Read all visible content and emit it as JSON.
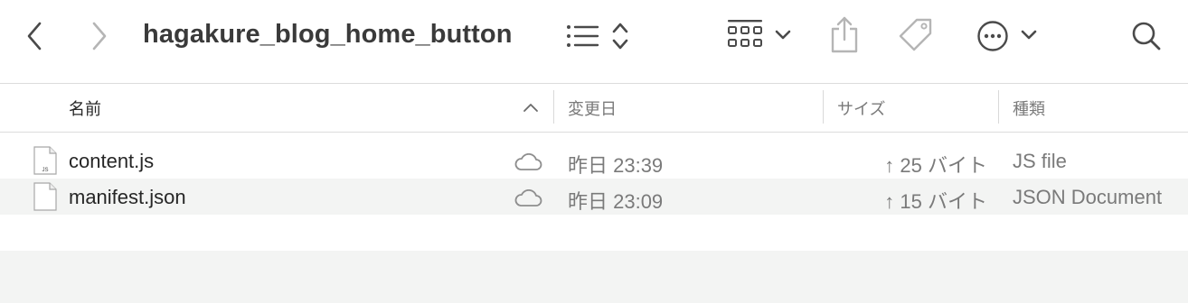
{
  "toolbar": {
    "title": "hagakure_blog_home_button",
    "icons": [
      "chevron-left-icon",
      "chevron-right-icon",
      "list-view-icon",
      "sort-updown-icon",
      "grid-view-icon",
      "chevron-down-icon",
      "share-icon",
      "tag-icon",
      "more-icon",
      "chevron-down-icon",
      "search-icon"
    ]
  },
  "columns": {
    "name": "名前",
    "date": "変更日",
    "size": "サイズ",
    "kind": "種類"
  },
  "files": [
    {
      "name": "content.js",
      "date": "昨日 23:39",
      "size": "↑ 25 バイト",
      "kind": "JS file",
      "icon": "js-file-icon",
      "icon_label": "JS"
    },
    {
      "name": "manifest.json",
      "date": "昨日 23:09",
      "size": "↑ 15 バイト",
      "kind": "JSON Document",
      "icon": "document-icon"
    }
  ],
  "colors": {
    "row_alt": "#f3f4f3",
    "secondary_text": "#7a7a7a"
  }
}
